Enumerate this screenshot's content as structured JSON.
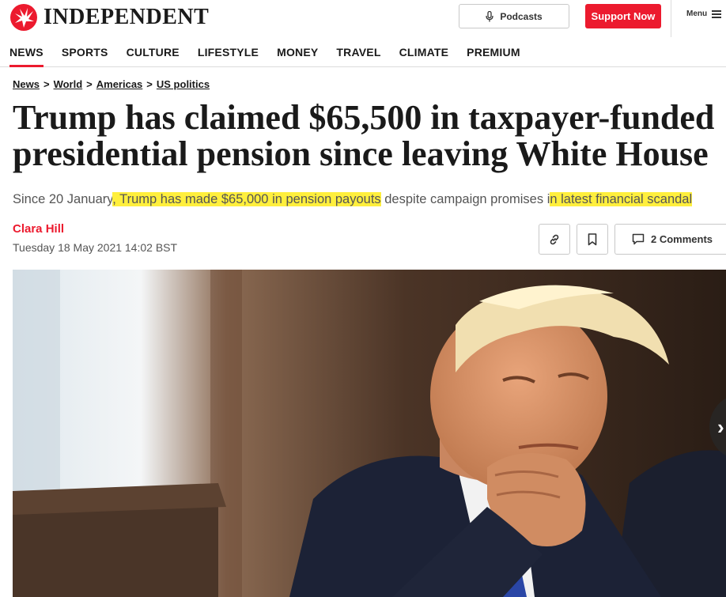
{
  "brand": {
    "name": "INDEPENDENT",
    "accent": "#ec1a2e",
    "highlight": "#ffef3d"
  },
  "header": {
    "podcasts_label": "Podcasts",
    "podcasts_icon": "microphone-icon",
    "support_label": "Support Now",
    "menu_label": "Menu",
    "menu_icon": "hamburger-icon"
  },
  "nav": {
    "items": [
      "NEWS",
      "SPORTS",
      "CULTURE",
      "LIFESTYLE",
      "MONEY",
      "TRAVEL",
      "CLIMATE",
      "PREMIUM"
    ],
    "active": "NEWS"
  },
  "breadcrumb": [
    "News",
    "World",
    "Americas",
    "US politics"
  ],
  "breadcrumb_separator": ">",
  "article": {
    "headline_line1": "Trump has claimed $65,500 in taxpayer-funded",
    "headline_line2": "presidential pension since leaving White House",
    "standfirst": {
      "part1": "Since 20 January",
      "hl1": ", Trump has made $65,000 in pension payouts",
      "part2": " despite campaign promises i",
      "hl2": "n latest financial scandal"
    },
    "author": "Clara Hill",
    "date": "Tuesday 18 May 2021 14:02 BST",
    "comments_label": "2 Comments",
    "share_icons": [
      "link-icon",
      "bookmark-icon",
      "comment-icon"
    ]
  },
  "hero_image": {
    "next_label": "›"
  }
}
